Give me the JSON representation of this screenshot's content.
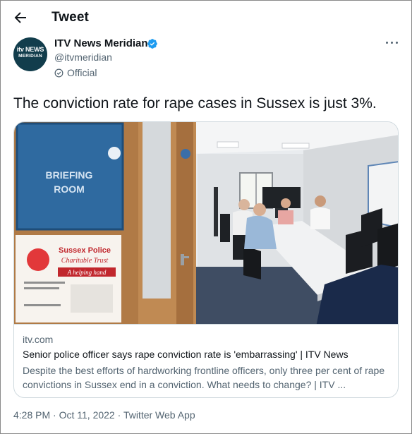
{
  "header": {
    "title": "Tweet"
  },
  "author": {
    "name": "ITV News Meridian",
    "handle": "@itvmeridian",
    "label": "Official",
    "avatar_text_top": "itv NEWS",
    "avatar_text_bottom": "MERIDIAN"
  },
  "tweet": {
    "text": "The conviction rate for rape cases in Sussex is just 3%."
  },
  "card": {
    "image_sign_line1": "BRIEFING",
    "image_sign_line2": "ROOM",
    "image_poster_line1": "Sussex Police",
    "image_poster_line2": "Charitable Trust",
    "image_poster_line3": "A helping hand",
    "domain": "itv.com",
    "title": "Senior police officer says rape conviction rate is 'embarrassing' | ITV News",
    "description": "Despite the best efforts of hardworking frontline officers, only three per cent of rape convictions in Sussex end in a conviction. What needs to change? | ITV ..."
  },
  "meta": {
    "time": "4:28 PM",
    "date": "Oct 11, 2022",
    "source": "Twitter Web App",
    "separator": " · "
  },
  "colors": {
    "text_primary": "#0f1419",
    "text_secondary": "#536471",
    "verified_blue": "#1d9bf0",
    "border": "#cfd9de"
  },
  "icons": {
    "back": "arrow-left-icon",
    "verified": "verified-badge-icon",
    "official": "check-circle-icon",
    "more": "more-horizontal-icon"
  }
}
